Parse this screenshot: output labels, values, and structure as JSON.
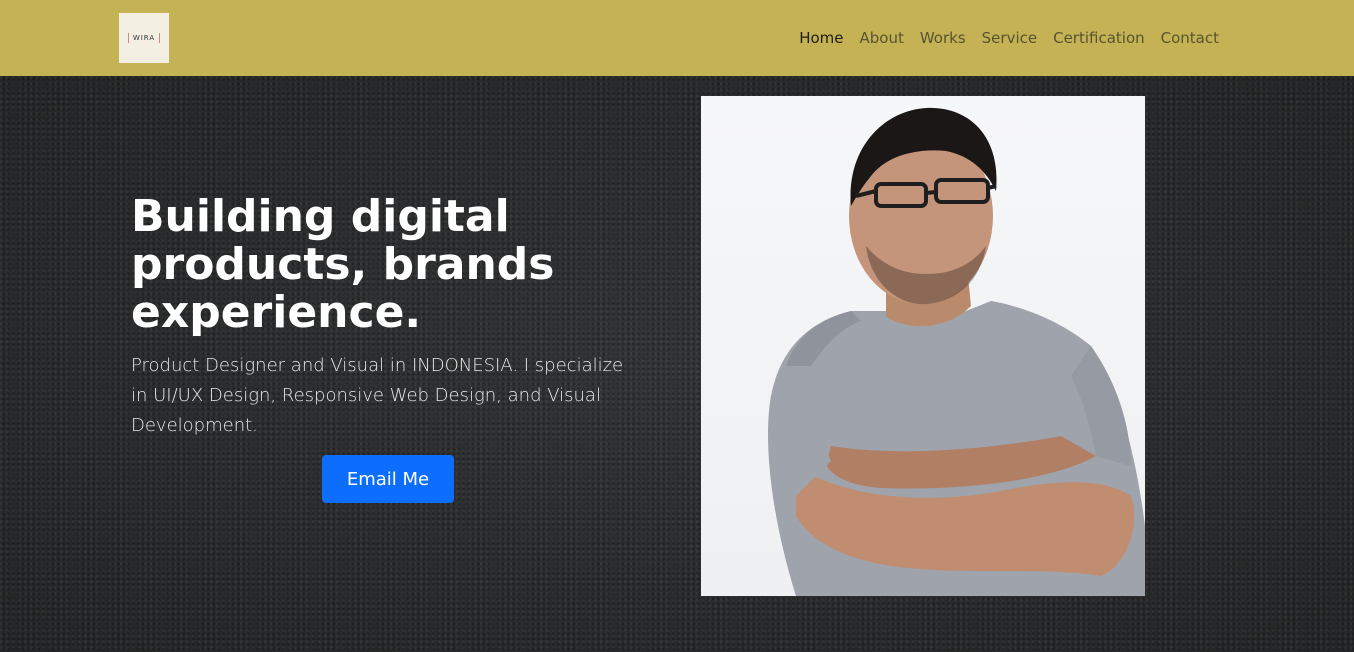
{
  "logo": {
    "text": "WIRA"
  },
  "nav": {
    "items": [
      {
        "label": "Home",
        "active": true
      },
      {
        "label": "About"
      },
      {
        "label": "Works"
      },
      {
        "label": "Service"
      },
      {
        "label": "Certification"
      },
      {
        "label": "Contact"
      }
    ]
  },
  "hero": {
    "headline": "Building digital products, brands experience.",
    "intro": "Product Designer and Visual in INDONESIA. I specialize in UI/UX Design, Responsive Web Design, and Visual Development.",
    "cta_label": "Email Me"
  },
  "colors": {
    "navbar": "#c4b254",
    "cta": "#0d6efd",
    "hero_bg": "#2b2d2e"
  }
}
